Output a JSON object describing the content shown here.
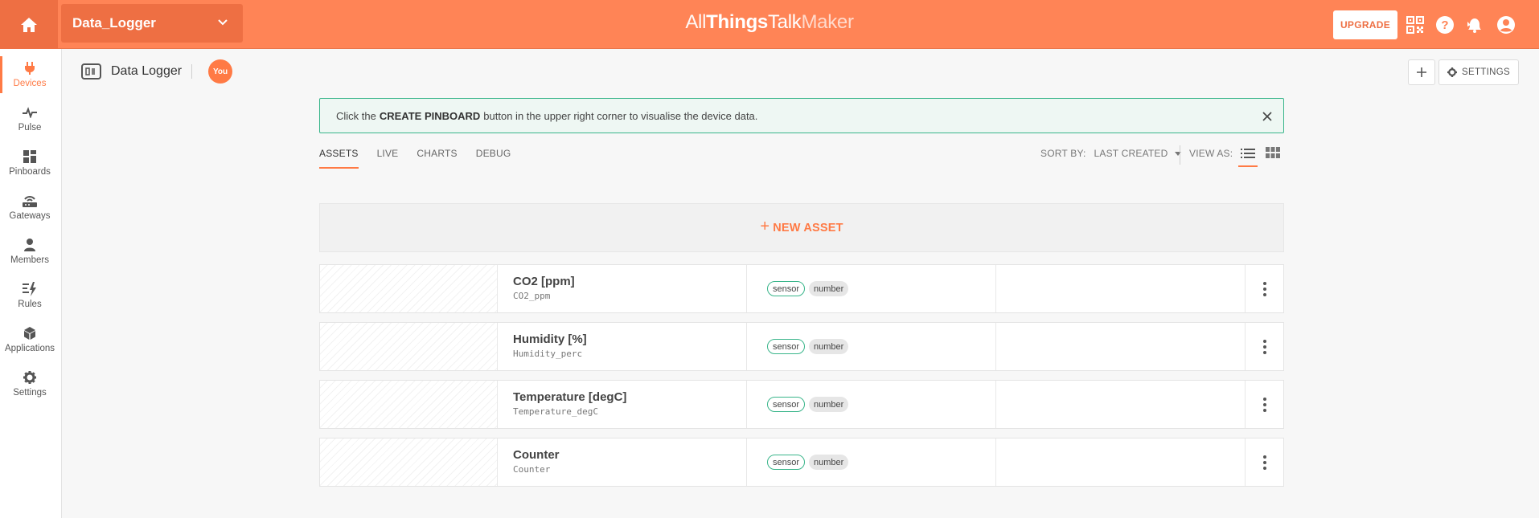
{
  "topbar": {
    "ground_name": "Data_Logger",
    "brand": {
      "part1": "All",
      "part2": "Things",
      "part3": "Talk",
      "part4": "Maker"
    },
    "upgrade_label": "UPGRADE",
    "accent_color": "#ff8456",
    "icons": [
      "home-icon",
      "chevron-down-icon",
      "qr-code-icon",
      "help-icon",
      "notifications-icon",
      "account-icon"
    ]
  },
  "sidebar": {
    "items": [
      {
        "label": "Devices",
        "icon": "plug-icon",
        "active": true
      },
      {
        "label": "Pulse",
        "icon": "pulse-icon"
      },
      {
        "label": "Pinboards",
        "icon": "pinboards-icon"
      },
      {
        "label": "Gateways",
        "icon": "gateway-icon"
      },
      {
        "label": "Members",
        "icon": "person-icon"
      },
      {
        "label": "Rules",
        "icon": "rules-icon"
      },
      {
        "label": "Applications",
        "icon": "cube-icon"
      },
      {
        "label": "Settings",
        "icon": "gear-icon"
      }
    ]
  },
  "device": {
    "title": "Data Logger",
    "owner_badge": "You",
    "add_label": "+",
    "settings_label": "SETTINGS"
  },
  "notice": {
    "prefix": "Click the",
    "bold": "CREATE PINBOARD",
    "suffix": "button in the upper right corner to visualise the device data."
  },
  "tabs": [
    {
      "label": "ASSETS",
      "active": true
    },
    {
      "label": "LIVE"
    },
    {
      "label": "CHARTS"
    },
    {
      "label": "DEBUG"
    }
  ],
  "sort": {
    "label": "SORT BY:",
    "value": "LAST CREATED"
  },
  "view_as": {
    "label": "VIEW AS:",
    "active": "list"
  },
  "new_asset_label": "NEW ASSET",
  "assets": [
    {
      "title": "CO2 [ppm]",
      "name": "CO2_ppm",
      "kind": "sensor",
      "type": "number"
    },
    {
      "title": "Humidity [%]",
      "name": "Humidity_perc",
      "kind": "sensor",
      "type": "number"
    },
    {
      "title": "Temperature [degC]",
      "name": "Temperature_degC",
      "kind": "sensor",
      "type": "number"
    },
    {
      "title": "Counter",
      "name": "Counter",
      "kind": "sensor",
      "type": "number"
    }
  ]
}
